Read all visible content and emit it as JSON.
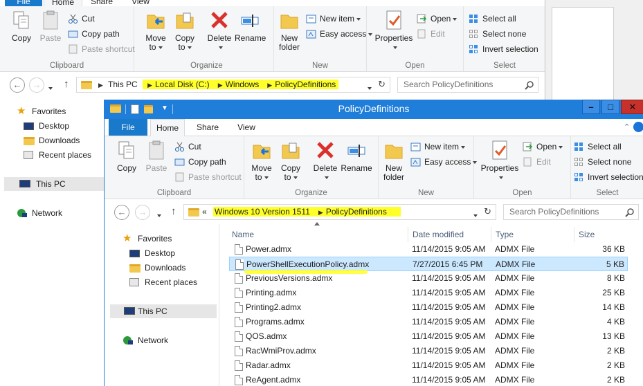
{
  "back_window": {
    "tabs": [
      "File",
      "Home",
      "Share",
      "View"
    ],
    "clipboard": {
      "copy": "Copy",
      "paste": "Paste",
      "cut": "Cut",
      "copy_path": "Copy path",
      "paste_shortcut": "Paste shortcut",
      "label": "Clipboard"
    },
    "organize": {
      "move_to": "Move",
      "move_to2": "to",
      "copy_to": "Copy",
      "copy_to2": "to",
      "delete": "Delete",
      "rename": "Rename",
      "label": "Organize"
    },
    "new": {
      "new_folder": "New",
      "new_folder2": "folder",
      "new_item": "New item",
      "easy_access": "Easy access",
      "label": "New"
    },
    "open": {
      "properties": "Properties",
      "open": "Open",
      "edit": "Edit",
      "label": "Open"
    },
    "select": {
      "select_all": "Select all",
      "select_none": "Select none",
      "invert": "Invert selection",
      "label": "Select"
    },
    "breadcrumb": [
      "This PC",
      "Local Disk (C:)",
      "Windows",
      "PolicyDefinitions"
    ],
    "search_placeholder": "Search PolicyDefinitions",
    "nav": {
      "favorites": "Favorites",
      "desktop": "Desktop",
      "downloads": "Downloads",
      "recent": "Recent places",
      "this_pc": "This PC",
      "network": "Network"
    }
  },
  "front_window": {
    "title": "PolicyDefinitions",
    "tabs": [
      "File",
      "Home",
      "Share",
      "View"
    ],
    "clipboard": {
      "copy": "Copy",
      "paste": "Paste",
      "cut": "Cut",
      "copy_path": "Copy path",
      "paste_shortcut": "Paste shortcut",
      "label": "Clipboard"
    },
    "organize": {
      "move_to": "Move",
      "move_to2": "to",
      "copy_to": "Copy",
      "copy_to2": "to",
      "delete": "Delete",
      "rename": "Rename",
      "label": "Organize"
    },
    "new": {
      "new_folder": "New",
      "new_folder2": "folder",
      "new_item": "New item",
      "easy_access": "Easy access",
      "label": "New"
    },
    "open": {
      "properties": "Properties",
      "open": "Open",
      "edit": "Edit",
      "label": "Open"
    },
    "select": {
      "select_all": "Select all",
      "select_none": "Select none",
      "invert": "Invert selection",
      "label": "Select"
    },
    "breadcrumb_prefix": "«",
    "breadcrumb": [
      "Windows 10 Version 1511",
      "PolicyDefinitions"
    ],
    "search_placeholder": "Search PolicyDefinitions",
    "nav": {
      "favorites": "Favorites",
      "desktop": "Desktop",
      "downloads": "Downloads",
      "recent": "Recent places",
      "this_pc": "This PC",
      "network": "Network"
    },
    "columns": {
      "name": "Name",
      "date": "Date modified",
      "type": "Type",
      "size": "Size"
    },
    "files": [
      {
        "name": "Power.admx",
        "date": "11/14/2015 9:05 AM",
        "type": "ADMX File",
        "size": "36 KB"
      },
      {
        "name": "PowerShellExecutionPolicy.admx",
        "date": "7/27/2015 6:45 PM",
        "type": "ADMX File",
        "size": "5 KB"
      },
      {
        "name": "PreviousVersions.admx",
        "date": "11/14/2015 9:05 AM",
        "type": "ADMX File",
        "size": "8 KB"
      },
      {
        "name": "Printing.admx",
        "date": "11/14/2015 9:05 AM",
        "type": "ADMX File",
        "size": "25 KB"
      },
      {
        "name": "Printing2.admx",
        "date": "11/14/2015 9:05 AM",
        "type": "ADMX File",
        "size": "14 KB"
      },
      {
        "name": "Programs.admx",
        "date": "11/14/2015 9:05 AM",
        "type": "ADMX File",
        "size": "4 KB"
      },
      {
        "name": "QOS.admx",
        "date": "11/14/2015 9:05 AM",
        "type": "ADMX File",
        "size": "13 KB"
      },
      {
        "name": "RacWmiProv.admx",
        "date": "11/14/2015 9:05 AM",
        "type": "ADMX File",
        "size": "2 KB"
      },
      {
        "name": "Radar.admx",
        "date": "11/14/2015 9:05 AM",
        "type": "ADMX File",
        "size": "2 KB"
      },
      {
        "name": "ReAgent.admx",
        "date": "11/14/2015 9:05 AM",
        "type": "ADMX File",
        "size": "2 KB"
      }
    ],
    "colors": {
      "titlebar": "#1f7ed9",
      "file_tab": "#1979ca",
      "selection": "#cce8ff",
      "highlight": "#ffff2a",
      "close": "#c7312b"
    }
  }
}
